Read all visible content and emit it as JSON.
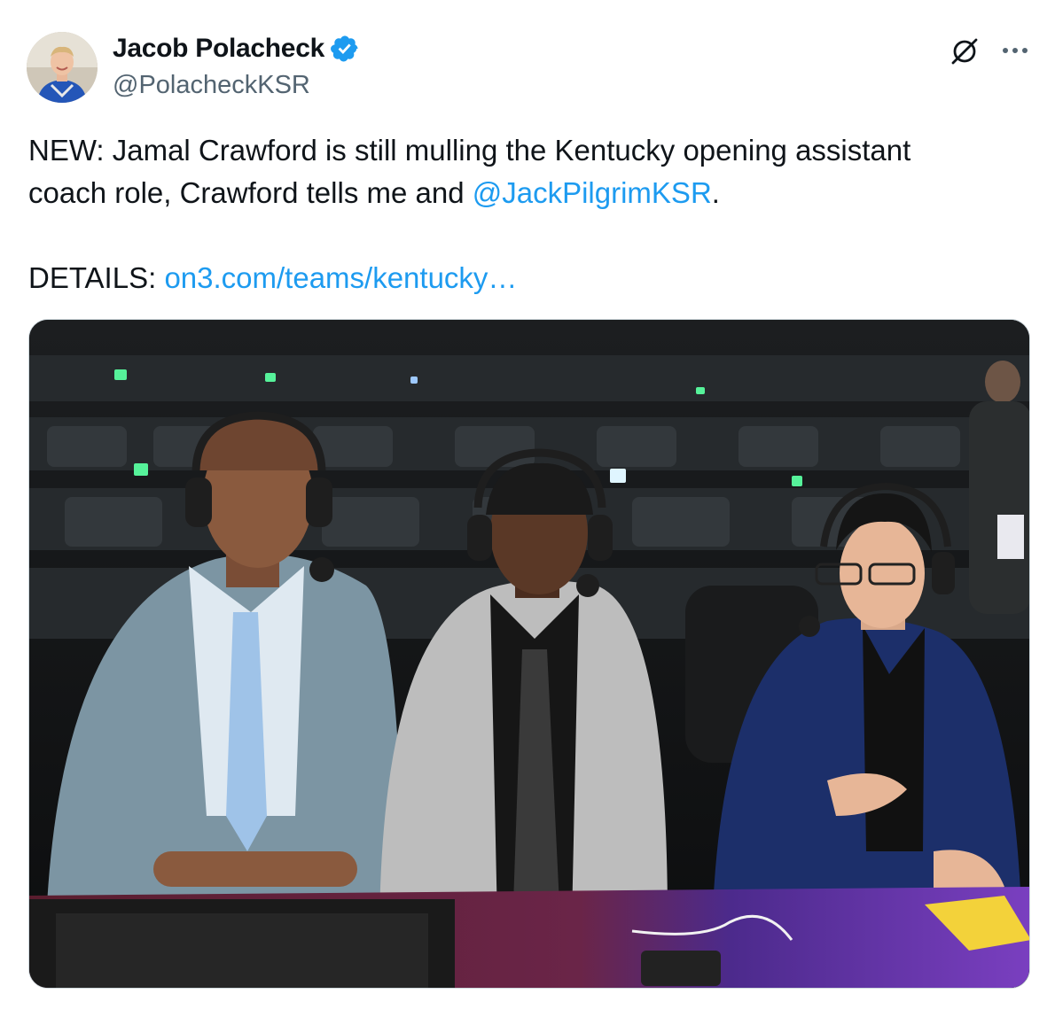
{
  "author": {
    "display_name": "Jacob Polacheck",
    "handle": "@PolacheckKSR",
    "verified": true,
    "avatar_icon": "profile-photo"
  },
  "actions": {
    "grok_icon": "grok-icon",
    "more_icon": "more-options-icon"
  },
  "tweet": {
    "line1": "NEW: Jamal Crawford is still mulling the Kentucky opening assistant",
    "line2_prefix": "coach role, Crawford tells me and ",
    "mention": "@JackPilgrimKSR",
    "line2_suffix": ".",
    "details_label": "DETAILS: ",
    "details_link": "on3.com/teams/kentucky…"
  },
  "media": {
    "type": "photo",
    "description_icon": "broadcast-desk-photo"
  },
  "colors": {
    "link": "#1d9bf0",
    "verified": "#1d9bf0",
    "text": "#0f1419",
    "secondary": "#536471"
  }
}
